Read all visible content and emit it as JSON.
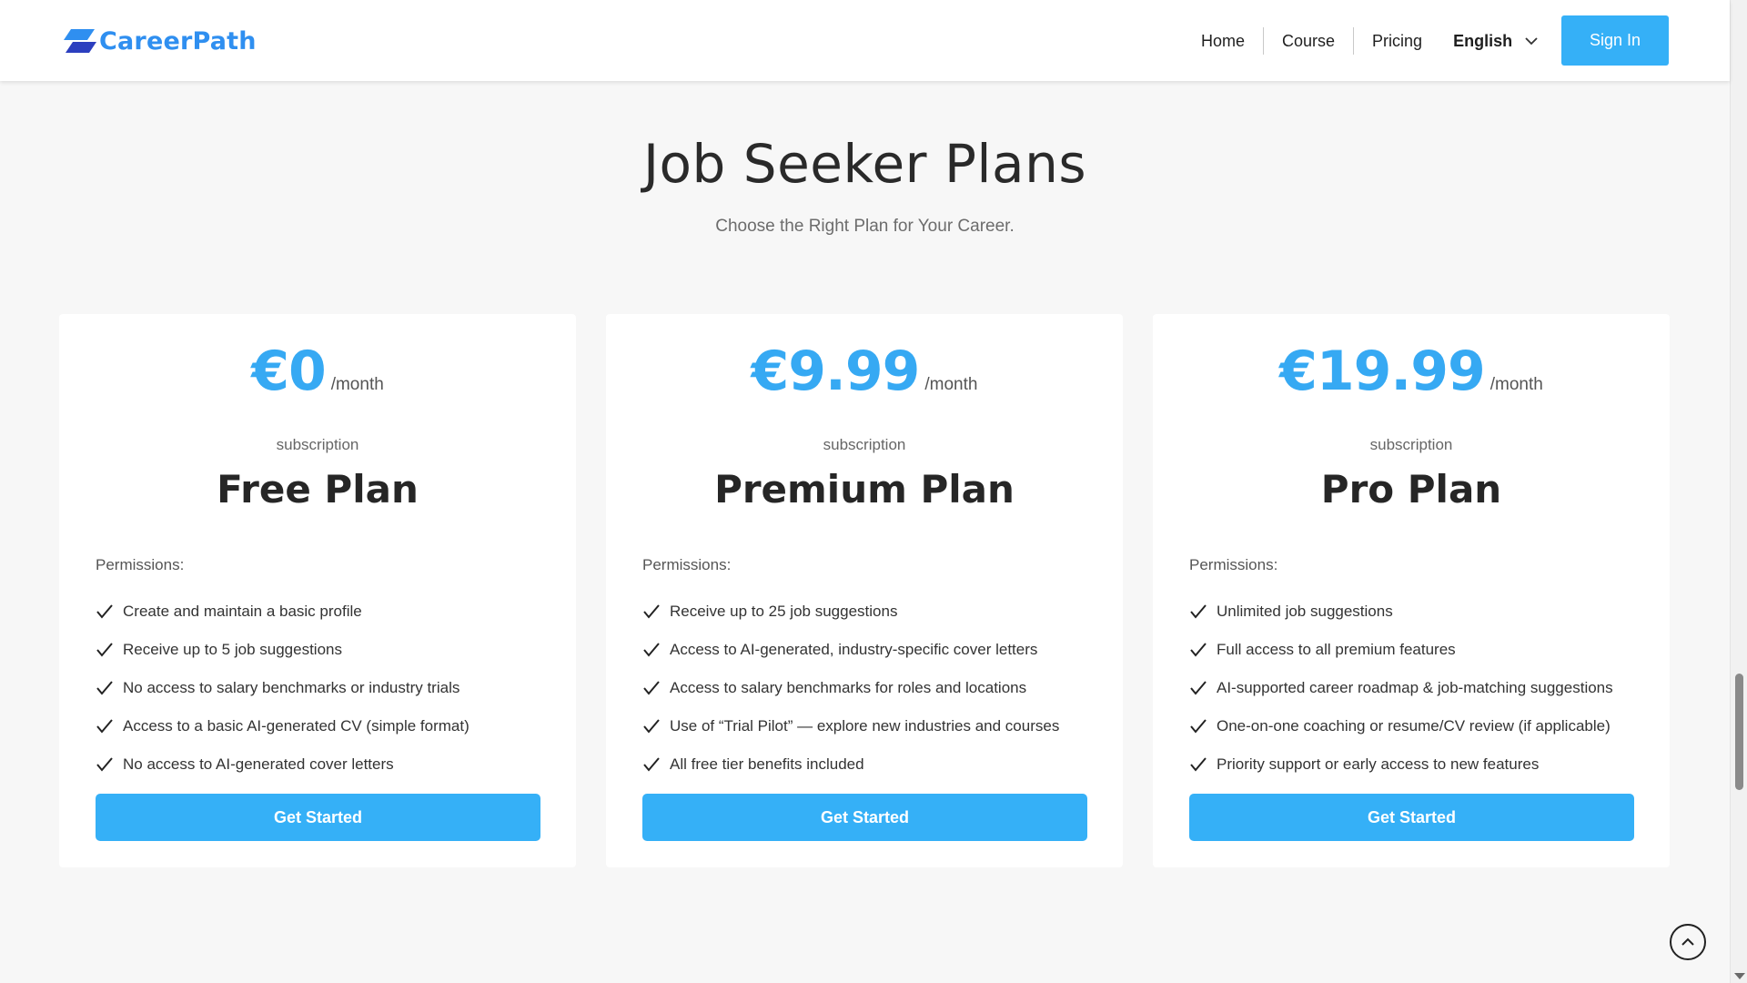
{
  "header": {
    "brand": "CareerPath",
    "brand_color": "#2f8ff0",
    "logo_icon": "careerpath-logo-icon",
    "nav": [
      {
        "label": "Home"
      },
      {
        "label": "Course"
      },
      {
        "label": "Pricing"
      }
    ],
    "language": {
      "selected": "English",
      "icon": "chevron-down-icon"
    },
    "sign_in_label": "Sign In"
  },
  "hero": {
    "title": "Job Seeker Plans",
    "subtitle": "Choose the Right Plan for Your Career."
  },
  "plans": [
    {
      "price": "€0",
      "period": "/month",
      "type_label": "subscription",
      "name": "Free Plan",
      "permissions_label": "Permissions:",
      "features": [
        "Create and maintain a basic profile",
        "Receive up to 5 job suggestions",
        "No access to salary benchmarks or industry trials",
        "Access to a basic AI-generated CV (simple format)",
        "No access to AI-generated cover letters"
      ],
      "cta_label": "Get Started"
    },
    {
      "price": "€9.99",
      "period": "/month",
      "type_label": "subscription",
      "name": "Premium Plan",
      "permissions_label": "Permissions:",
      "features": [
        "Receive up to 25 job suggestions",
        "Access to AI-generated, industry-specific cover letters",
        "Access to salary benchmarks for roles and locations",
        "Use of “Trial Pilot” — explore new industries and courses",
        "All free tier benefits included"
      ],
      "cta_label": "Get Started"
    },
    {
      "price": "€19.99",
      "period": "/month",
      "type_label": "subscription",
      "name": "Pro Plan",
      "permissions_label": "Permissions:",
      "features": [
        "Unlimited job suggestions",
        "Full access to all premium features",
        "AI-supported career roadmap & job-matching suggestions",
        "One-on-one coaching or resume/CV review (if applicable)",
        "Priority support or early access to new features"
      ],
      "cta_label": "Get Started"
    }
  ],
  "colors": {
    "accent": "#35b0f7",
    "price": "#36a9f3",
    "background": "#f7f7f7"
  },
  "icons": {
    "check": "check-icon",
    "back_to_top": "chevron-up-icon"
  }
}
